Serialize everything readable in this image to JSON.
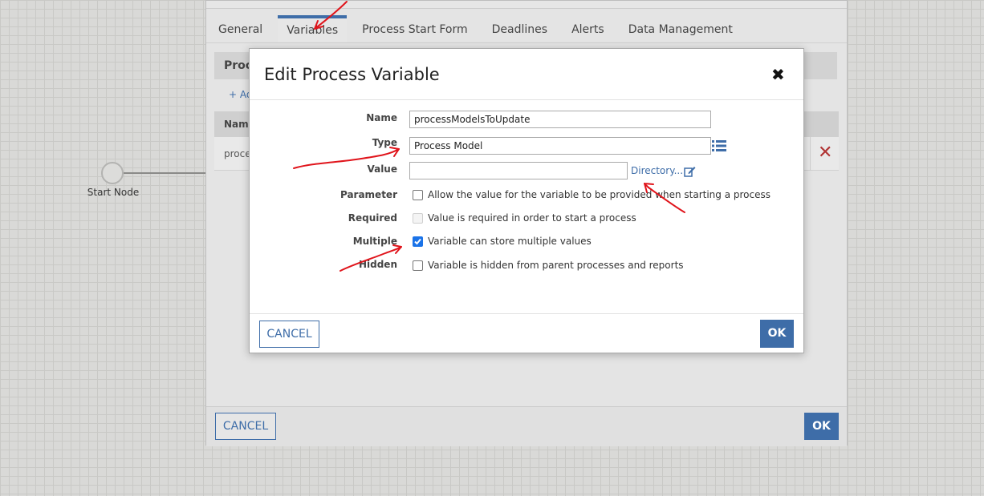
{
  "canvas": {
    "start_node_label": "Start Node"
  },
  "background_dialog": {
    "tabs": [
      {
        "label": "General"
      },
      {
        "label": "Variables"
      },
      {
        "label": "Process Start Form"
      },
      {
        "label": "Deadlines"
      },
      {
        "label": "Alerts"
      },
      {
        "label": "Data Management"
      }
    ],
    "active_tab": "Variables",
    "panel_heading": "Proc",
    "add_link": "+ Ad",
    "table_header": "Name",
    "table_row_name": "proce",
    "delete_icon": "close-icon",
    "cancel_label": "CANCEL",
    "ok_label": "OK"
  },
  "modal": {
    "title": "Edit Process Variable",
    "close_icon": "close-icon",
    "fields": {
      "name": {
        "label": "Name",
        "value": "processModelsToUpdate"
      },
      "type": {
        "label": "Type",
        "value": "Process Model"
      },
      "value": {
        "label": "Value",
        "value": "",
        "directory_link": "Directory..."
      },
      "parameter": {
        "label": "Parameter",
        "checked": false,
        "text": "Allow the value for the variable to be provided when starting a process"
      },
      "required": {
        "label": "Required",
        "checked": false,
        "disabled": true,
        "text": "Value is required in order to start a process"
      },
      "multiple": {
        "label": "Multiple",
        "checked": true,
        "text": "Variable can store multiple values"
      },
      "hidden": {
        "label": "Hidden",
        "checked": false,
        "text": "Variable is hidden from parent processes and reports"
      }
    },
    "cancel_label": "CANCEL",
    "ok_label": "OK"
  },
  "colors": {
    "accent": "#3e6da8",
    "annotation_red": "#e0141b",
    "delete_red": "#b03333"
  }
}
